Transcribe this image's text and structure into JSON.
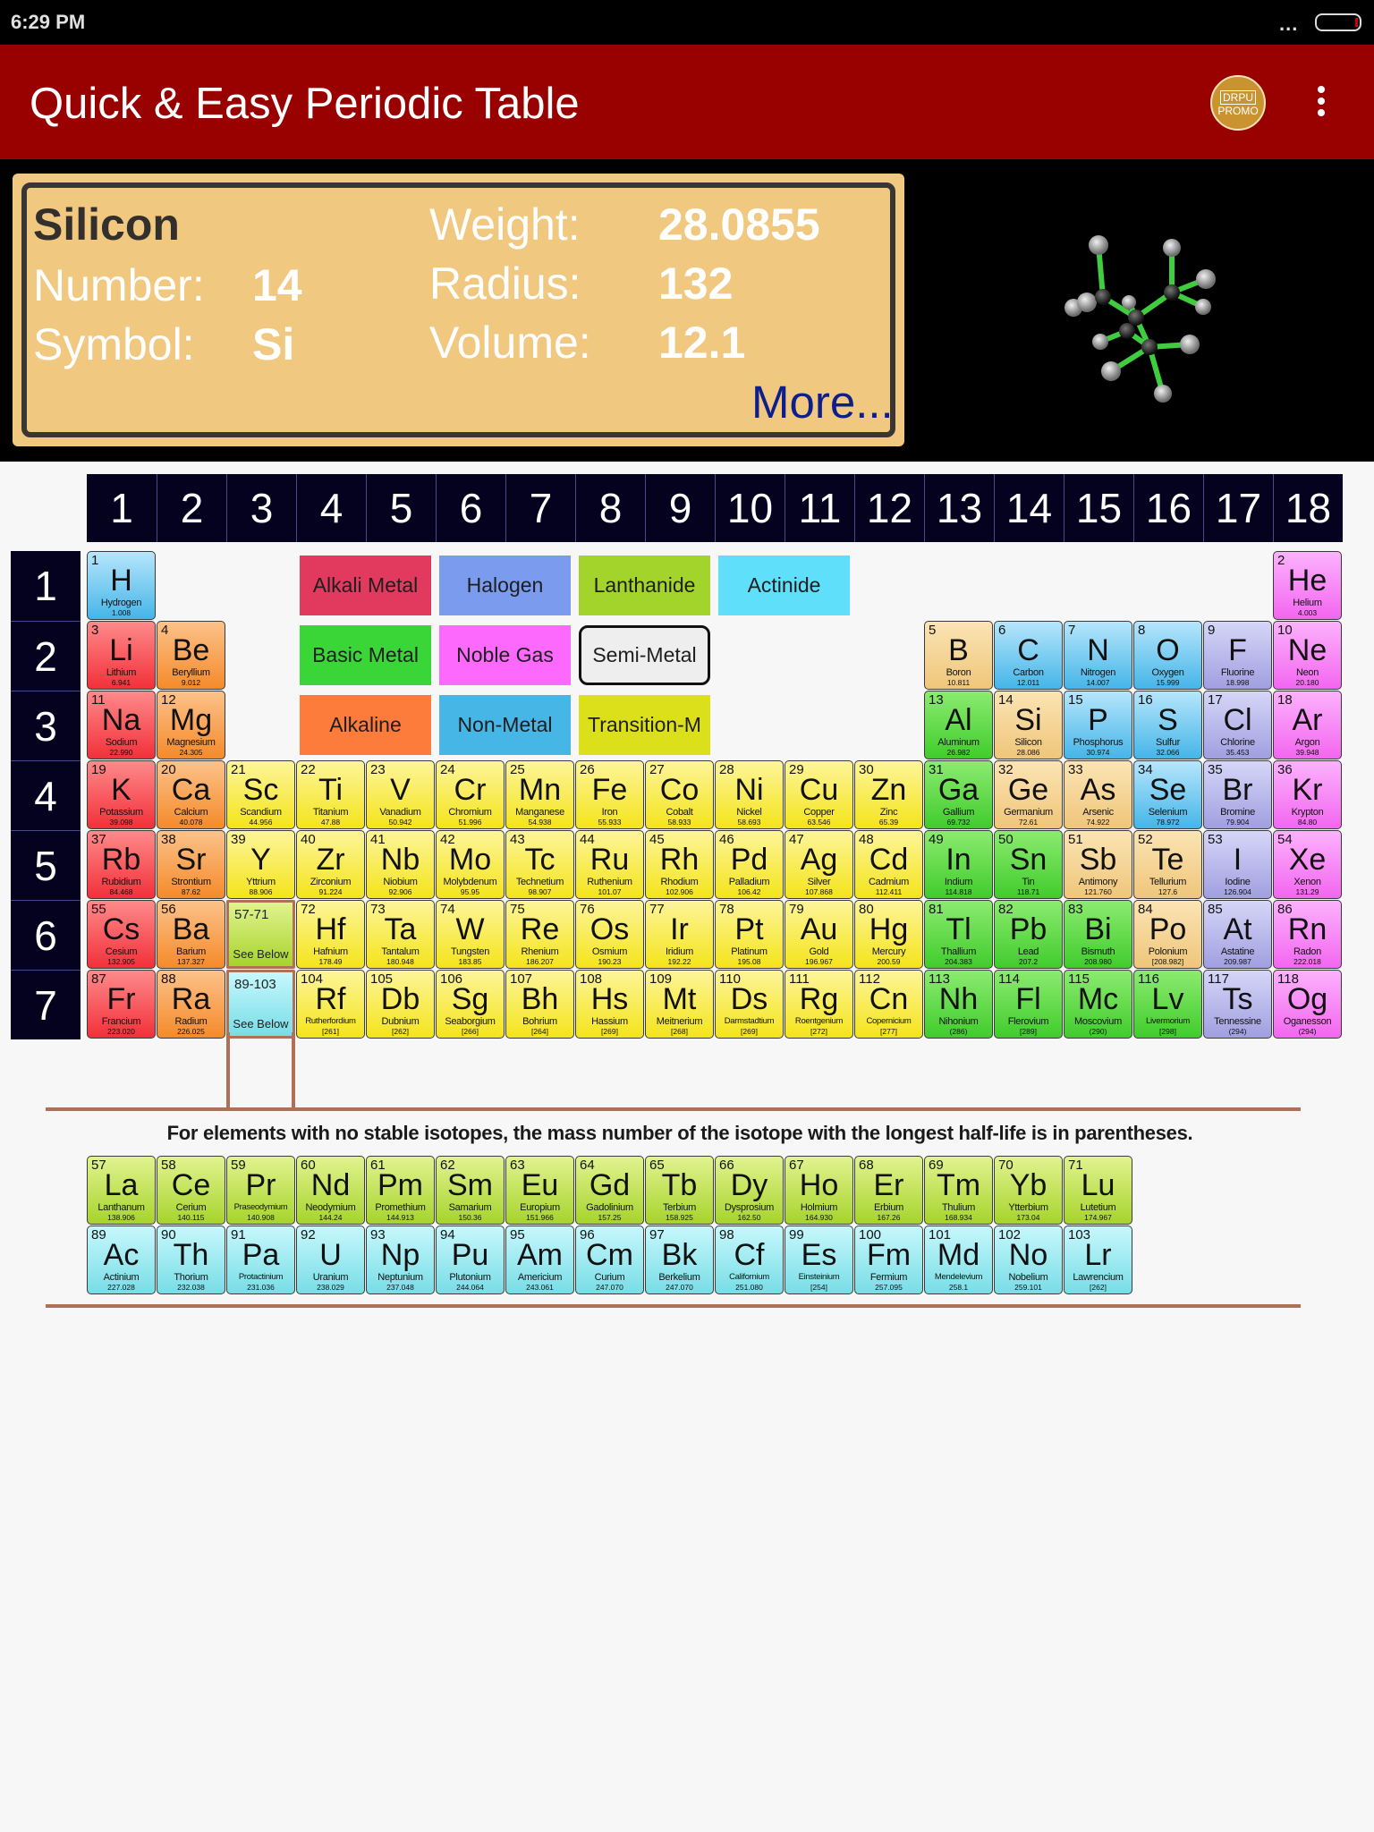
{
  "status_bar": {
    "time": "6:29 PM",
    "signal": "..."
  },
  "app_bar": {
    "title": "Quick & Easy Periodic Table",
    "promo_top": "DRPU",
    "promo_bottom": "PROMO"
  },
  "info_panel": {
    "element_name": "Silicon",
    "number_label": "Number:",
    "number_value": "14",
    "symbol_label": "Symbol:",
    "symbol_value": "Si",
    "weight_label": "Weight:",
    "weight_value": "28.0855",
    "radius_label": "Radius:",
    "radius_value": "132",
    "volume_label": "Volume:",
    "volume_value": "12.1",
    "more_link": "More...",
    "model_image": "silicon-molecule-ball-and-stick-model"
  },
  "groups": [
    "1",
    "2",
    "3",
    "4",
    "5",
    "6",
    "7",
    "8",
    "9",
    "10",
    "11",
    "12",
    "13",
    "14",
    "15",
    "16",
    "17",
    "18"
  ],
  "periods": [
    "1",
    "2",
    "3",
    "4",
    "5",
    "6",
    "7"
  ],
  "legend": [
    {
      "label": "Alkali Metal",
      "color": "#e23a5f",
      "row": 0,
      "col": 0
    },
    {
      "label": "Halogen",
      "color": "#7a9bee",
      "row": 0,
      "col": 1
    },
    {
      "label": "Lanthanide",
      "color": "#a3d42c",
      "row": 0,
      "col": 2
    },
    {
      "label": "Actinide",
      "color": "#5fdffa",
      "row": 0,
      "col": 3
    },
    {
      "label": "Basic Metal",
      "color": "#3ad537",
      "row": 1,
      "col": 0
    },
    {
      "label": "Noble Gas",
      "color": "#fe69fd",
      "row": 1,
      "col": 1
    },
    {
      "label": "Semi-Metal",
      "color": "#eeeeee",
      "row": 1,
      "col": 2,
      "selected": true
    },
    {
      "label": "Alkaline",
      "color": "#fd7b3b",
      "row": 2,
      "col": 0
    },
    {
      "label": "Non-Metal",
      "color": "#45b6e6",
      "row": 2,
      "col": 1
    },
    {
      "label": "Transition-M",
      "color": "#dbe01a",
      "row": 2,
      "col": 2
    }
  ],
  "placeholders": [
    {
      "range": "57-71",
      "label": "See Below",
      "category": "lanth",
      "period": 6,
      "group": 3
    },
    {
      "range": "89-103",
      "label": "See Below",
      "category": "act",
      "period": 7,
      "group": 3
    }
  ],
  "footnote": "For elements with no stable isotopes, the mass number of the isotope with the longest half-life is in parentheses.",
  "elements": [
    {
      "n": "1",
      "s": "H",
      "name": "Hydrogen",
      "w": "1.008",
      "c": "hydrogen",
      "p": 1,
      "g": 1
    },
    {
      "n": "2",
      "s": "He",
      "name": "Helium",
      "w": "4.003",
      "c": "noble",
      "p": 1,
      "g": 18
    },
    {
      "n": "3",
      "s": "Li",
      "name": "Lithium",
      "w": "6.941",
      "c": "alkali",
      "p": 2,
      "g": 1
    },
    {
      "n": "4",
      "s": "Be",
      "name": "Beryllium",
      "w": "9.012",
      "c": "alkaline",
      "p": 2,
      "g": 2
    },
    {
      "n": "5",
      "s": "B",
      "name": "Boron",
      "w": "10.811",
      "c": "semi",
      "p": 2,
      "g": 13
    },
    {
      "n": "6",
      "s": "C",
      "name": "Carbon",
      "w": "12.011",
      "c": "nonmetal",
      "p": 2,
      "g": 14
    },
    {
      "n": "7",
      "s": "N",
      "name": "Nitrogen",
      "w": "14.007",
      "c": "nonmetal",
      "p": 2,
      "g": 15
    },
    {
      "n": "8",
      "s": "O",
      "name": "Oxygen",
      "w": "15.999",
      "c": "nonmetal",
      "p": 2,
      "g": 16
    },
    {
      "n": "9",
      "s": "F",
      "name": "Fluorine",
      "w": "18.998",
      "c": "halogen",
      "p": 2,
      "g": 17
    },
    {
      "n": "10",
      "s": "Ne",
      "name": "Neon",
      "w": "20.180",
      "c": "noble",
      "p": 2,
      "g": 18
    },
    {
      "n": "11",
      "s": "Na",
      "name": "Sodium",
      "w": "22.990",
      "c": "alkali",
      "p": 3,
      "g": 1
    },
    {
      "n": "12",
      "s": "Mg",
      "name": "Magnesium",
      "w": "24.305",
      "c": "alkaline",
      "p": 3,
      "g": 2
    },
    {
      "n": "13",
      "s": "Al",
      "name": "Aluminum",
      "w": "26.982",
      "c": "basic",
      "p": 3,
      "g": 13
    },
    {
      "n": "14",
      "s": "Si",
      "name": "Silicon",
      "w": "28.086",
      "c": "semi",
      "p": 3,
      "g": 14
    },
    {
      "n": "15",
      "s": "P",
      "name": "Phosphorus",
      "w": "30.974",
      "c": "nonmetal",
      "p": 3,
      "g": 15
    },
    {
      "n": "16",
      "s": "S",
      "name": "Sulfur",
      "w": "32.066",
      "c": "nonmetal",
      "p": 3,
      "g": 16
    },
    {
      "n": "17",
      "s": "Cl",
      "name": "Chlorine",
      "w": "35.453",
      "c": "halogen",
      "p": 3,
      "g": 17
    },
    {
      "n": "18",
      "s": "Ar",
      "name": "Argon",
      "w": "39.948",
      "c": "noble",
      "p": 3,
      "g": 18
    },
    {
      "n": "19",
      "s": "K",
      "name": "Potassium",
      "w": "39.098",
      "c": "alkali",
      "p": 4,
      "g": 1
    },
    {
      "n": "20",
      "s": "Ca",
      "name": "Calcium",
      "w": "40.078",
      "c": "alkaline",
      "p": 4,
      "g": 2
    },
    {
      "n": "21",
      "s": "Sc",
      "name": "Scandium",
      "w": "44.956",
      "c": "transition",
      "p": 4,
      "g": 3
    },
    {
      "n": "22",
      "s": "Ti",
      "name": "Titanium",
      "w": "47.88",
      "c": "transition",
      "p": 4,
      "g": 4
    },
    {
      "n": "23",
      "s": "V",
      "name": "Vanadium",
      "w": "50.942",
      "c": "transition",
      "p": 4,
      "g": 5
    },
    {
      "n": "24",
      "s": "Cr",
      "name": "Chromium",
      "w": "51.996",
      "c": "transition",
      "p": 4,
      "g": 6
    },
    {
      "n": "25",
      "s": "Mn",
      "name": "Manganese",
      "w": "54.938",
      "c": "transition",
      "p": 4,
      "g": 7
    },
    {
      "n": "26",
      "s": "Fe",
      "name": "Iron",
      "w": "55.933",
      "c": "transition",
      "p": 4,
      "g": 8
    },
    {
      "n": "27",
      "s": "Co",
      "name": "Cobalt",
      "w": "58.933",
      "c": "transition",
      "p": 4,
      "g": 9
    },
    {
      "n": "28",
      "s": "Ni",
      "name": "Nickel",
      "w": "58.693",
      "c": "transition",
      "p": 4,
      "g": 10
    },
    {
      "n": "29",
      "s": "Cu",
      "name": "Copper",
      "w": "63.546",
      "c": "transition",
      "p": 4,
      "g": 11
    },
    {
      "n": "30",
      "s": "Zn",
      "name": "Zinc",
      "w": "65.39",
      "c": "transition",
      "p": 4,
      "g": 12
    },
    {
      "n": "31",
      "s": "Ga",
      "name": "Gallium",
      "w": "69.732",
      "c": "basic",
      "p": 4,
      "g": 13
    },
    {
      "n": "32",
      "s": "Ge",
      "name": "Germanium",
      "w": "72.61",
      "c": "semi",
      "p": 4,
      "g": 14
    },
    {
      "n": "33",
      "s": "As",
      "name": "Arsenic",
      "w": "74.922",
      "c": "semi",
      "p": 4,
      "g": 15
    },
    {
      "n": "34",
      "s": "Se",
      "name": "Selenium",
      "w": "78.972",
      "c": "nonmetal",
      "p": 4,
      "g": 16
    },
    {
      "n": "35",
      "s": "Br",
      "name": "Bromine",
      "w": "79.904",
      "c": "halogen",
      "p": 4,
      "g": 17
    },
    {
      "n": "36",
      "s": "Kr",
      "name": "Krypton",
      "w": "84.80",
      "c": "noble",
      "p": 4,
      "g": 18
    },
    {
      "n": "37",
      "s": "Rb",
      "name": "Rubidium",
      "w": "84.468",
      "c": "alkali",
      "p": 5,
      "g": 1
    },
    {
      "n": "38",
      "s": "Sr",
      "name": "Strontium",
      "w": "87.62",
      "c": "alkaline",
      "p": 5,
      "g": 2
    },
    {
      "n": "39",
      "s": "Y",
      "name": "Yttrium",
      "w": "88.906",
      "c": "transition",
      "p": 5,
      "g": 3
    },
    {
      "n": "40",
      "s": "Zr",
      "name": "Zirconium",
      "w": "91.224",
      "c": "transition",
      "p": 5,
      "g": 4
    },
    {
      "n": "41",
      "s": "Nb",
      "name": "Niobium",
      "w": "92.906",
      "c": "transition",
      "p": 5,
      "g": 5
    },
    {
      "n": "42",
      "s": "Mo",
      "name": "Molybdenum",
      "w": "95.95",
      "c": "transition",
      "p": 5,
      "g": 6
    },
    {
      "n": "43",
      "s": "Tc",
      "name": "Technetium",
      "w": "98.907",
      "c": "transition",
      "p": 5,
      "g": 7
    },
    {
      "n": "44",
      "s": "Ru",
      "name": "Ruthenium",
      "w": "101.07",
      "c": "transition",
      "p": 5,
      "g": 8
    },
    {
      "n": "45",
      "s": "Rh",
      "name": "Rhodium",
      "w": "102.906",
      "c": "transition",
      "p": 5,
      "g": 9
    },
    {
      "n": "46",
      "s": "Pd",
      "name": "Palladium",
      "w": "106.42",
      "c": "transition",
      "p": 5,
      "g": 10
    },
    {
      "n": "47",
      "s": "Ag",
      "name": "Silver",
      "w": "107.868",
      "c": "transition",
      "p": 5,
      "g": 11
    },
    {
      "n": "48",
      "s": "Cd",
      "name": "Cadmium",
      "w": "112.411",
      "c": "transition",
      "p": 5,
      "g": 12
    },
    {
      "n": "49",
      "s": "In",
      "name": "Indium",
      "w": "114.818",
      "c": "basic",
      "p": 5,
      "g": 13
    },
    {
      "n": "50",
      "s": "Sn",
      "name": "Tin",
      "w": "118.71",
      "c": "basic",
      "p": 5,
      "g": 14
    },
    {
      "n": "51",
      "s": "Sb",
      "name": "Antimony",
      "w": "121.760",
      "c": "semi",
      "p": 5,
      "g": 15
    },
    {
      "n": "52",
      "s": "Te",
      "name": "Tellurium",
      "w": "127.6",
      "c": "semi",
      "p": 5,
      "g": 16
    },
    {
      "n": "53",
      "s": "I",
      "name": "Iodine",
      "w": "126.904",
      "c": "halogen",
      "p": 5,
      "g": 17
    },
    {
      "n": "54",
      "s": "Xe",
      "name": "Xenon",
      "w": "131.29",
      "c": "noble",
      "p": 5,
      "g": 18
    },
    {
      "n": "55",
      "s": "Cs",
      "name": "Cesium",
      "w": "132.905",
      "c": "alkali",
      "p": 6,
      "g": 1
    },
    {
      "n": "56",
      "s": "Ba",
      "name": "Barium",
      "w": "137.327",
      "c": "alkaline",
      "p": 6,
      "g": 2
    },
    {
      "n": "72",
      "s": "Hf",
      "name": "Hafnium",
      "w": "178.49",
      "c": "transition",
      "p": 6,
      "g": 4
    },
    {
      "n": "73",
      "s": "Ta",
      "name": "Tantalum",
      "w": "180.948",
      "c": "transition",
      "p": 6,
      "g": 5
    },
    {
      "n": "74",
      "s": "W",
      "name": "Tungsten",
      "w": "183.85",
      "c": "transition",
      "p": 6,
      "g": 6
    },
    {
      "n": "75",
      "s": "Re",
      "name": "Rhenium",
      "w": "186.207",
      "c": "transition",
      "p": 6,
      "g": 7
    },
    {
      "n": "76",
      "s": "Os",
      "name": "Osmium",
      "w": "190.23",
      "c": "transition",
      "p": 6,
      "g": 8
    },
    {
      "n": "77",
      "s": "Ir",
      "name": "Iridium",
      "w": "192.22",
      "c": "transition",
      "p": 6,
      "g": 9
    },
    {
      "n": "78",
      "s": "Pt",
      "name": "Platinum",
      "w": "195.08",
      "c": "transition",
      "p": 6,
      "g": 10
    },
    {
      "n": "79",
      "s": "Au",
      "name": "Gold",
      "w": "196.967",
      "c": "transition",
      "p": 6,
      "g": 11
    },
    {
      "n": "80",
      "s": "Hg",
      "name": "Mercury",
      "w": "200.59",
      "c": "transition",
      "p": 6,
      "g": 12
    },
    {
      "n": "81",
      "s": "Tl",
      "name": "Thallium",
      "w": "204.383",
      "c": "basic",
      "p": 6,
      "g": 13
    },
    {
      "n": "82",
      "s": "Pb",
      "name": "Lead",
      "w": "207.2",
      "c": "basic",
      "p": 6,
      "g": 14
    },
    {
      "n": "83",
      "s": "Bi",
      "name": "Bismuth",
      "w": "208.980",
      "c": "basic",
      "p": 6,
      "g": 15
    },
    {
      "n": "84",
      "s": "Po",
      "name": "Polonium",
      "w": "[208.982]",
      "c": "semi",
      "p": 6,
      "g": 16
    },
    {
      "n": "85",
      "s": "At",
      "name": "Astatine",
      "w": "209.987",
      "c": "halogen",
      "p": 6,
      "g": 17
    },
    {
      "n": "86",
      "s": "Rn",
      "name": "Radon",
      "w": "222.018",
      "c": "noble",
      "p": 6,
      "g": 18
    },
    {
      "n": "87",
      "s": "Fr",
      "name": "Francium",
      "w": "223.020",
      "c": "alkali",
      "p": 7,
      "g": 1
    },
    {
      "n": "88",
      "s": "Ra",
      "name": "Radium",
      "w": "226.025",
      "c": "alkaline",
      "p": 7,
      "g": 2
    },
    {
      "n": "104",
      "s": "Rf",
      "name": "Rutherfordium",
      "w": "[261]",
      "c": "transition",
      "p": 7,
      "g": 4
    },
    {
      "n": "105",
      "s": "Db",
      "name": "Dubnium",
      "w": "[262]",
      "c": "transition",
      "p": 7,
      "g": 5
    },
    {
      "n": "106",
      "s": "Sg",
      "name": "Seaborgium",
      "w": "[266]",
      "c": "transition",
      "p": 7,
      "g": 6
    },
    {
      "n": "107",
      "s": "Bh",
      "name": "Bohrium",
      "w": "[264]",
      "c": "transition",
      "p": 7,
      "g": 7
    },
    {
      "n": "108",
      "s": "Hs",
      "name": "Hassium",
      "w": "[269]",
      "c": "transition",
      "p": 7,
      "g": 8
    },
    {
      "n": "109",
      "s": "Mt",
      "name": "Meitnerium",
      "w": "[268]",
      "c": "transition",
      "p": 7,
      "g": 9
    },
    {
      "n": "110",
      "s": "Ds",
      "name": "Darmstadtium",
      "w": "[269]",
      "c": "transition",
      "p": 7,
      "g": 10
    },
    {
      "n": "111",
      "s": "Rg",
      "name": "Roentgenium",
      "w": "[272]",
      "c": "transition",
      "p": 7,
      "g": 11
    },
    {
      "n": "112",
      "s": "Cn",
      "name": "Copernicium",
      "w": "[277]",
      "c": "transition",
      "p": 7,
      "g": 12
    },
    {
      "n": "113",
      "s": "Nh",
      "name": "Nihonium",
      "w": "(286)",
      "c": "basic",
      "p": 7,
      "g": 13
    },
    {
      "n": "114",
      "s": "Fl",
      "name": "Flerovium",
      "w": "[289]",
      "c": "basic",
      "p": 7,
      "g": 14
    },
    {
      "n": "115",
      "s": "Mc",
      "name": "Moscovium",
      "w": "(290)",
      "c": "basic",
      "p": 7,
      "g": 15
    },
    {
      "n": "116",
      "s": "Lv",
      "name": "Livermorium",
      "w": "[298]",
      "c": "basic",
      "p": 7,
      "g": 16
    },
    {
      "n": "117",
      "s": "Ts",
      "name": "Tennessine",
      "w": "(294)",
      "c": "halogen",
      "p": 7,
      "g": 17
    },
    {
      "n": "118",
      "s": "Og",
      "name": "Oganesson",
      "w": "(294)",
      "c": "noble",
      "p": 7,
      "g": 18
    }
  ],
  "lanthanides": [
    {
      "n": "57",
      "s": "La",
      "name": "Lanthanum",
      "w": "138.906"
    },
    {
      "n": "58",
      "s": "Ce",
      "name": "Cerium",
      "w": "140.115"
    },
    {
      "n": "59",
      "s": "Pr",
      "name": "Praseodymium",
      "w": "140.908"
    },
    {
      "n": "60",
      "s": "Nd",
      "name": "Neodymium",
      "w": "144.24"
    },
    {
      "n": "61",
      "s": "Pm",
      "name": "Promethium",
      "w": "144.913"
    },
    {
      "n": "62",
      "s": "Sm",
      "name": "Samarium",
      "w": "150.36"
    },
    {
      "n": "63",
      "s": "Eu",
      "name": "Europium",
      "w": "151.966"
    },
    {
      "n": "64",
      "s": "Gd",
      "name": "Gadolinium",
      "w": "157.25"
    },
    {
      "n": "65",
      "s": "Tb",
      "name": "Terbium",
      "w": "158.925"
    },
    {
      "n": "66",
      "s": "Dy",
      "name": "Dysprosium",
      "w": "162.50"
    },
    {
      "n": "67",
      "s": "Ho",
      "name": "Holmium",
      "w": "164.930"
    },
    {
      "n": "68",
      "s": "Er",
      "name": "Erbium",
      "w": "167.26"
    },
    {
      "n": "69",
      "s": "Tm",
      "name": "Thulium",
      "w": "168.934"
    },
    {
      "n": "70",
      "s": "Yb",
      "name": "Ytterbium",
      "w": "173.04"
    },
    {
      "n": "71",
      "s": "Lu",
      "name": "Lutetium",
      "w": "174.967"
    }
  ],
  "actinides": [
    {
      "n": "89",
      "s": "Ac",
      "name": "Actinium",
      "w": "227.028"
    },
    {
      "n": "90",
      "s": "Th",
      "name": "Thorium",
      "w": "232.038"
    },
    {
      "n": "91",
      "s": "Pa",
      "name": "Protactinium",
      "w": "231.036"
    },
    {
      "n": "92",
      "s": "U",
      "name": "Uranium",
      "w": "238.029"
    },
    {
      "n": "93",
      "s": "Np",
      "name": "Neptunium",
      "w": "237.048"
    },
    {
      "n": "94",
      "s": "Pu",
      "name": "Plutonium",
      "w": "244.064"
    },
    {
      "n": "95",
      "s": "Am",
      "name": "Americium",
      "w": "243.061"
    },
    {
      "n": "96",
      "s": "Cm",
      "name": "Curium",
      "w": "247.070"
    },
    {
      "n": "97",
      "s": "Bk",
      "name": "Berkelium",
      "w": "247.070"
    },
    {
      "n": "98",
      "s": "Cf",
      "name": "Californium",
      "w": "251.080"
    },
    {
      "n": "99",
      "s": "Es",
      "name": "Einsteinium",
      "w": "[254]"
    },
    {
      "n": "100",
      "s": "Fm",
      "name": "Fermium",
      "w": "257.095"
    },
    {
      "n": "101",
      "s": "Md",
      "name": "Mendelevium",
      "w": "258.1"
    },
    {
      "n": "102",
      "s": "No",
      "name": "Nobelium",
      "w": "259.101"
    },
    {
      "n": "103",
      "s": "Lr",
      "name": "Lawrencium",
      "w": "[262]"
    }
  ]
}
